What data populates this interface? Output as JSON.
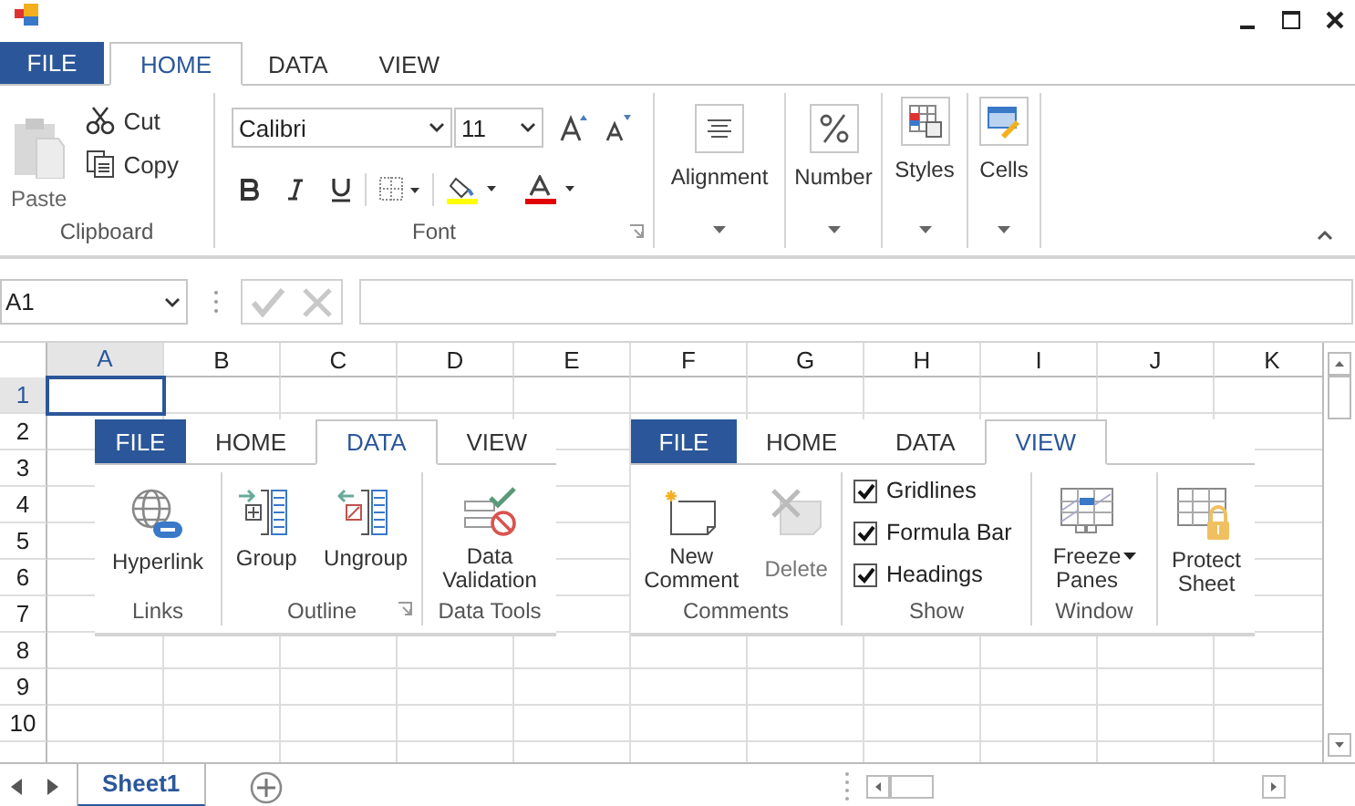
{
  "tabs": [
    {
      "label": "FILE",
      "selected": false
    },
    {
      "label": "HOME",
      "selected": true
    },
    {
      "label": "DATA",
      "selected": false
    },
    {
      "label": "VIEW",
      "selected": false
    }
  ],
  "clipboard": {
    "label": "Clipboard",
    "paste": {
      "label": "Paste",
      "disabled": true
    },
    "cut": "Cut",
    "copy": "Copy"
  },
  "font": {
    "label": "Font",
    "name": "Calibri",
    "size": "11"
  },
  "alignment": {
    "label": "Alignment"
  },
  "number": {
    "label": "Number"
  },
  "styles": {
    "label": "Styles"
  },
  "cells": {
    "label": "Cells"
  },
  "formula_bar": {
    "name_box": "A1"
  },
  "columns": [
    {
      "label": "A",
      "selected": true
    },
    {
      "label": "B",
      "selected": false
    },
    {
      "label": "C",
      "selected": false
    },
    {
      "label": "D",
      "selected": false
    },
    {
      "label": "E",
      "selected": false
    },
    {
      "label": "F",
      "selected": false
    },
    {
      "label": "G",
      "selected": false
    },
    {
      "label": "H",
      "selected": false
    },
    {
      "label": "I",
      "selected": false
    },
    {
      "label": "J",
      "selected": false
    },
    {
      "label": "K",
      "selected": false
    }
  ],
  "rows": [
    {
      "label": "1",
      "selected": true
    },
    {
      "label": "2",
      "selected": false
    },
    {
      "label": "3",
      "selected": false
    },
    {
      "label": "4",
      "selected": false
    },
    {
      "label": "5",
      "selected": false
    },
    {
      "label": "6",
      "selected": false
    },
    {
      "label": "7",
      "selected": false
    },
    {
      "label": "8",
      "selected": false
    },
    {
      "label": "9",
      "selected": false
    },
    {
      "label": "10",
      "selected": false
    }
  ],
  "sheet_tabs": [
    {
      "label": "Sheet1",
      "selected": true
    }
  ],
  "data_panel": {
    "tabs": [
      {
        "label": "FILE",
        "selected": false
      },
      {
        "label": "HOME",
        "selected": false
      },
      {
        "label": "DATA",
        "selected": true
      },
      {
        "label": "VIEW",
        "selected": false
      }
    ],
    "links": {
      "label": "Links",
      "hyperlink": "Hyperlink"
    },
    "outline": {
      "label": "Outline",
      "group": "Group",
      "ungroup": "Ungroup"
    },
    "data_tools": {
      "label": "Data Tools",
      "validation": "Data Validation"
    }
  },
  "view_panel": {
    "tabs": [
      {
        "label": "FILE",
        "selected": false
      },
      {
        "label": "HOME",
        "selected": false
      },
      {
        "label": "DATA",
        "selected": false
      },
      {
        "label": "VIEW",
        "selected": true
      }
    ],
    "comments": {
      "label": "Comments",
      "new": "New Comment",
      "delete": {
        "label": "Delete",
        "disabled": true
      }
    },
    "show": {
      "label": "Show",
      "options": [
        {
          "label": "Gridlines",
          "checked": true
        },
        {
          "label": "Formula Bar",
          "checked": true
        },
        {
          "label": "Headings",
          "checked": true
        }
      ]
    },
    "window": {
      "label": "Window",
      "freeze": "Freeze Panes"
    },
    "protect": "Protect Sheet"
  }
}
